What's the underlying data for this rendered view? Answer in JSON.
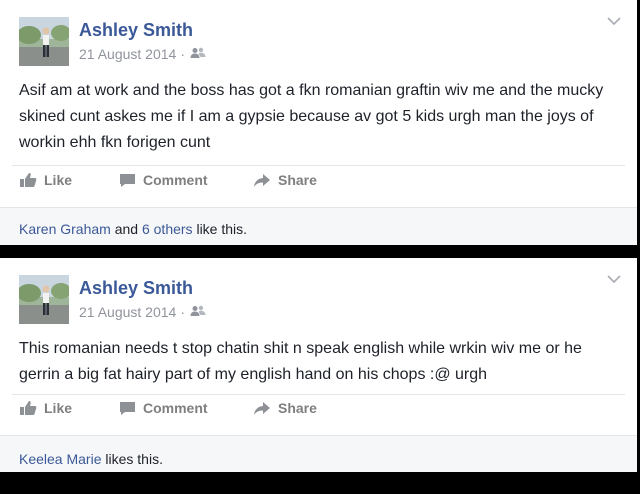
{
  "posts": [
    {
      "author": "Ashley Smith",
      "date": "21 August 2014",
      "audience_icon": "friends-icon",
      "text": "Asif am at work and the boss has got a fkn romanian graftin wiv me and the mucky skined cunt askes me if I am a gypsie because av got 5 kids urgh man the joys of workin ehh fkn forigen cunt",
      "actions": {
        "like": "Like",
        "comment": "Comment",
        "share": "Share"
      },
      "likes": {
        "name": "Karen Graham",
        "and": "and",
        "others": "6 others",
        "suffix": "like this."
      }
    },
    {
      "author": "Ashley Smith",
      "date": "21 August 2014",
      "audience_icon": "friends-icon",
      "text": "This romanian needs t stop chatin shit n speak english while wrkin wiv me or he gerrin a big fat hairy part of my english hand on his chops :@ urgh",
      "actions": {
        "like": "Like",
        "comment": "Comment",
        "share": "Share"
      },
      "likes": {
        "name": "Keelea Marie",
        "suffix": "likes this."
      }
    }
  ],
  "colors": {
    "link": "#3b5998",
    "meta": "#90949c",
    "text": "#1d2129",
    "action": "#7f7f7f",
    "likes_bg": "#f6f7f9"
  }
}
